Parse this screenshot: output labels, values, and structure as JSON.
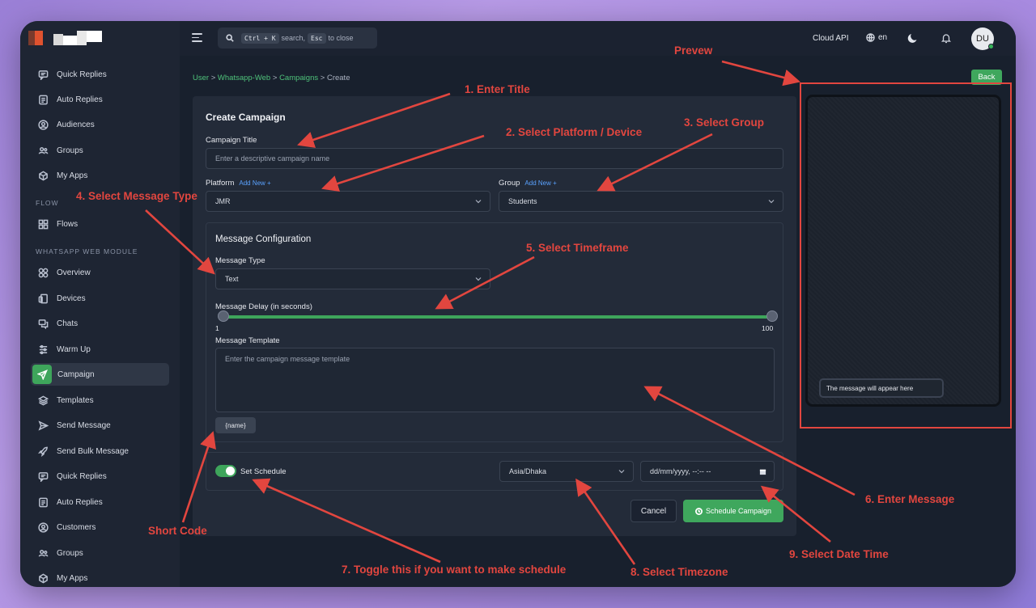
{
  "sidebar": {
    "items": [
      {
        "label": "Quick Replies",
        "icon": "chat-reply-icon"
      },
      {
        "label": "Auto Replies",
        "icon": "auto-reply-icon"
      },
      {
        "label": "Audiences",
        "icon": "user-circle-icon"
      },
      {
        "label": "Groups",
        "icon": "group-icon"
      },
      {
        "label": "My Apps",
        "icon": "apps-icon"
      },
      {
        "label": "Flows",
        "icon": "grid-icon"
      },
      {
        "label": "Overview",
        "icon": "overview-icon"
      },
      {
        "label": "Devices",
        "icon": "devices-icon"
      },
      {
        "label": "Chats",
        "icon": "chats-icon"
      },
      {
        "label": "Warm Up",
        "icon": "warmup-icon"
      },
      {
        "label": "Campaign",
        "icon": "send-icon"
      },
      {
        "label": "Templates",
        "icon": "layers-icon"
      },
      {
        "label": "Send Message",
        "icon": "send-message-icon"
      },
      {
        "label": "Send Bulk Message",
        "icon": "rocket-icon"
      },
      {
        "label": "Quick Replies",
        "icon": "chat-reply-icon"
      },
      {
        "label": "Auto Replies",
        "icon": "auto-reply-icon"
      },
      {
        "label": "Customers",
        "icon": "user-circle-icon"
      },
      {
        "label": "Groups",
        "icon": "group-icon"
      },
      {
        "label": "My Apps",
        "icon": "apps-icon"
      }
    ],
    "headings": {
      "flow": "FLOW",
      "whatsapp": "WHATSAPP WEB MODULE"
    }
  },
  "topbar": {
    "search": {
      "key1": "Ctrl + K",
      "text1": "search,",
      "key2": "Esc",
      "text2": "to close"
    },
    "cloud_api": "Cloud API",
    "language": "en",
    "avatar": "DU"
  },
  "breadcrumb": {
    "user": "User",
    "sep": ">",
    "whatsapp_web": "Whatsapp-Web",
    "campaigns": "Campaigns",
    "create": "Create"
  },
  "back_label": "Back",
  "form": {
    "title": "Create Campaign",
    "campaign_title_label": "Campaign Title",
    "campaign_title_placeholder": "Enter a descriptive campaign name",
    "platform_label": "Platform",
    "platform_value": "JMR",
    "group_label": "Group",
    "group_value": "Students",
    "add_new": "Add New +",
    "config_title": "Message Configuration",
    "message_type_label": "Message Type",
    "message_type_value": "Text",
    "delay_label": "Message Delay (in seconds)",
    "delay_min": "1",
    "delay_max": "100",
    "template_label": "Message Template",
    "template_placeholder": "Enter the campaign message template",
    "shortcode": "{name}",
    "schedule_label": "Set Schedule",
    "timezone_value": "Asia/Dhaka",
    "datetime_placeholder": "dd/mm/yyyy, --:-- --",
    "cancel": "Cancel",
    "schedule_button": "Schedule Campaign"
  },
  "preview": {
    "bubble": "The message will appear here"
  },
  "annotations": {
    "preview": "Prevew",
    "title": "1. Enter Title",
    "platform": "2. Select Platform / Device",
    "group": "3. Select Group",
    "message_type": "4. Select Message Type",
    "timeframe": "5. Select Timeframe",
    "message": "6. Enter Message",
    "toggle": "7. Toggle this if you want to make schedule",
    "timezone": "8. Select Timezone",
    "datetime": "9. Select Date Time",
    "shortcode": "Short Code"
  },
  "colors": {
    "accent": "#3fa75d",
    "annotation": "#e2463f",
    "link": "#5aa2ff"
  }
}
